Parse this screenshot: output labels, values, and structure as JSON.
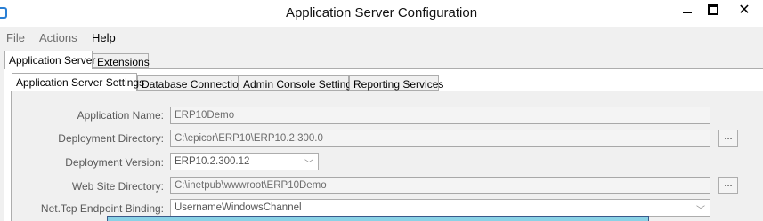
{
  "window": {
    "title": "Application Server Configuration",
    "close_glyph": "✕"
  },
  "menu": {
    "items": [
      "File",
      "Actions",
      "Help"
    ]
  },
  "outer_tabs": [
    "Application Server",
    "Extensions"
  ],
  "inner_tabs": [
    "Application Server Settings",
    "Database Connection",
    "Admin Console Settings",
    "Reporting Services"
  ],
  "form": {
    "app_name": {
      "label": "Application Name:",
      "value": "ERP10Demo"
    },
    "deploy_dir": {
      "label": "Deployment Directory:",
      "value": "C:\\epicor\\ERP10\\ERP10.2.300.0"
    },
    "deploy_ver": {
      "label": "Deployment Version:",
      "value": "ERP10.2.300.12"
    },
    "web_dir": {
      "label": "Web Site Directory:",
      "value": "C:\\inetpub\\wwwroot\\ERP10Demo"
    },
    "binding": {
      "label": "Net.Tcp Endpoint Binding:",
      "value": "UsernameWindowsChannel"
    }
  },
  "browse_label": "...",
  "chevron_glyph": "﹀",
  "icons": [
    "app-icon",
    "minimize-icon",
    "maximize-icon",
    "close-icon",
    "chevron-down-icon"
  ]
}
